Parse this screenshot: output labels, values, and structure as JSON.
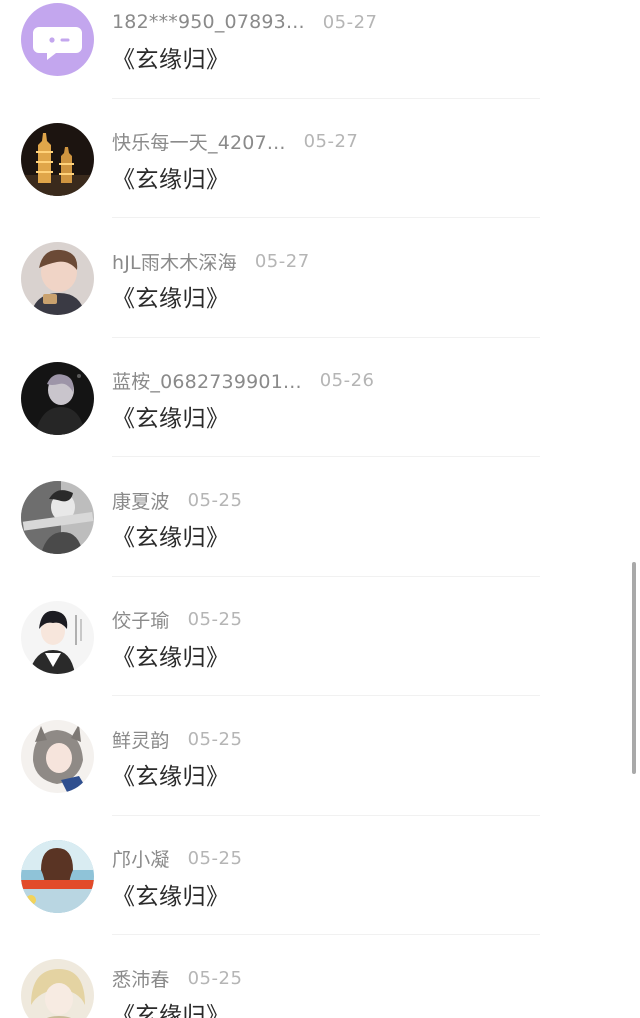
{
  "comments": [
    {
      "name": "182***950_07893...",
      "date": "05-27",
      "title": "《玄缘归》",
      "avatar": "chat-bubble-avatar-icon"
    },
    {
      "name": "快乐每一天_4207...",
      "date": "05-27",
      "title": "《玄缘归》",
      "avatar": "night-pagoda-avatar"
    },
    {
      "name": "hJL雨木木深海",
      "date": "05-27",
      "title": "《玄缘归》",
      "avatar": "person-avatar"
    },
    {
      "name": "蓝桉_0682739901...",
      "date": "05-26",
      "title": "《玄缘归》",
      "avatar": "dark-person-avatar"
    },
    {
      "name": "康夏波",
      "date": "05-25",
      "title": "《玄缘归》",
      "avatar": "grey-illustration-avatar"
    },
    {
      "name": "佼子瑜",
      "date": "05-25",
      "title": "《玄缘归》",
      "avatar": "anime-boy-avatar"
    },
    {
      "name": "鲜灵韵",
      "date": "05-25",
      "title": "《玄缘归》",
      "avatar": "anime-girl-avatar"
    },
    {
      "name": "邝小凝",
      "date": "05-25",
      "title": "《玄缘归》",
      "avatar": "girl-photo-avatar"
    },
    {
      "name": "悉沛春",
      "date": "05-25",
      "title": "《玄缘归》",
      "avatar": "blonde-illustration-avatar"
    }
  ],
  "colors": {
    "name": "#8a8a8a",
    "date": "#b5b5b5",
    "title": "#2a2a2a",
    "divider": "#f1f1f1",
    "scrollbar": "#a9a9a9",
    "first_avatar_bg": "#c3a6ee"
  }
}
